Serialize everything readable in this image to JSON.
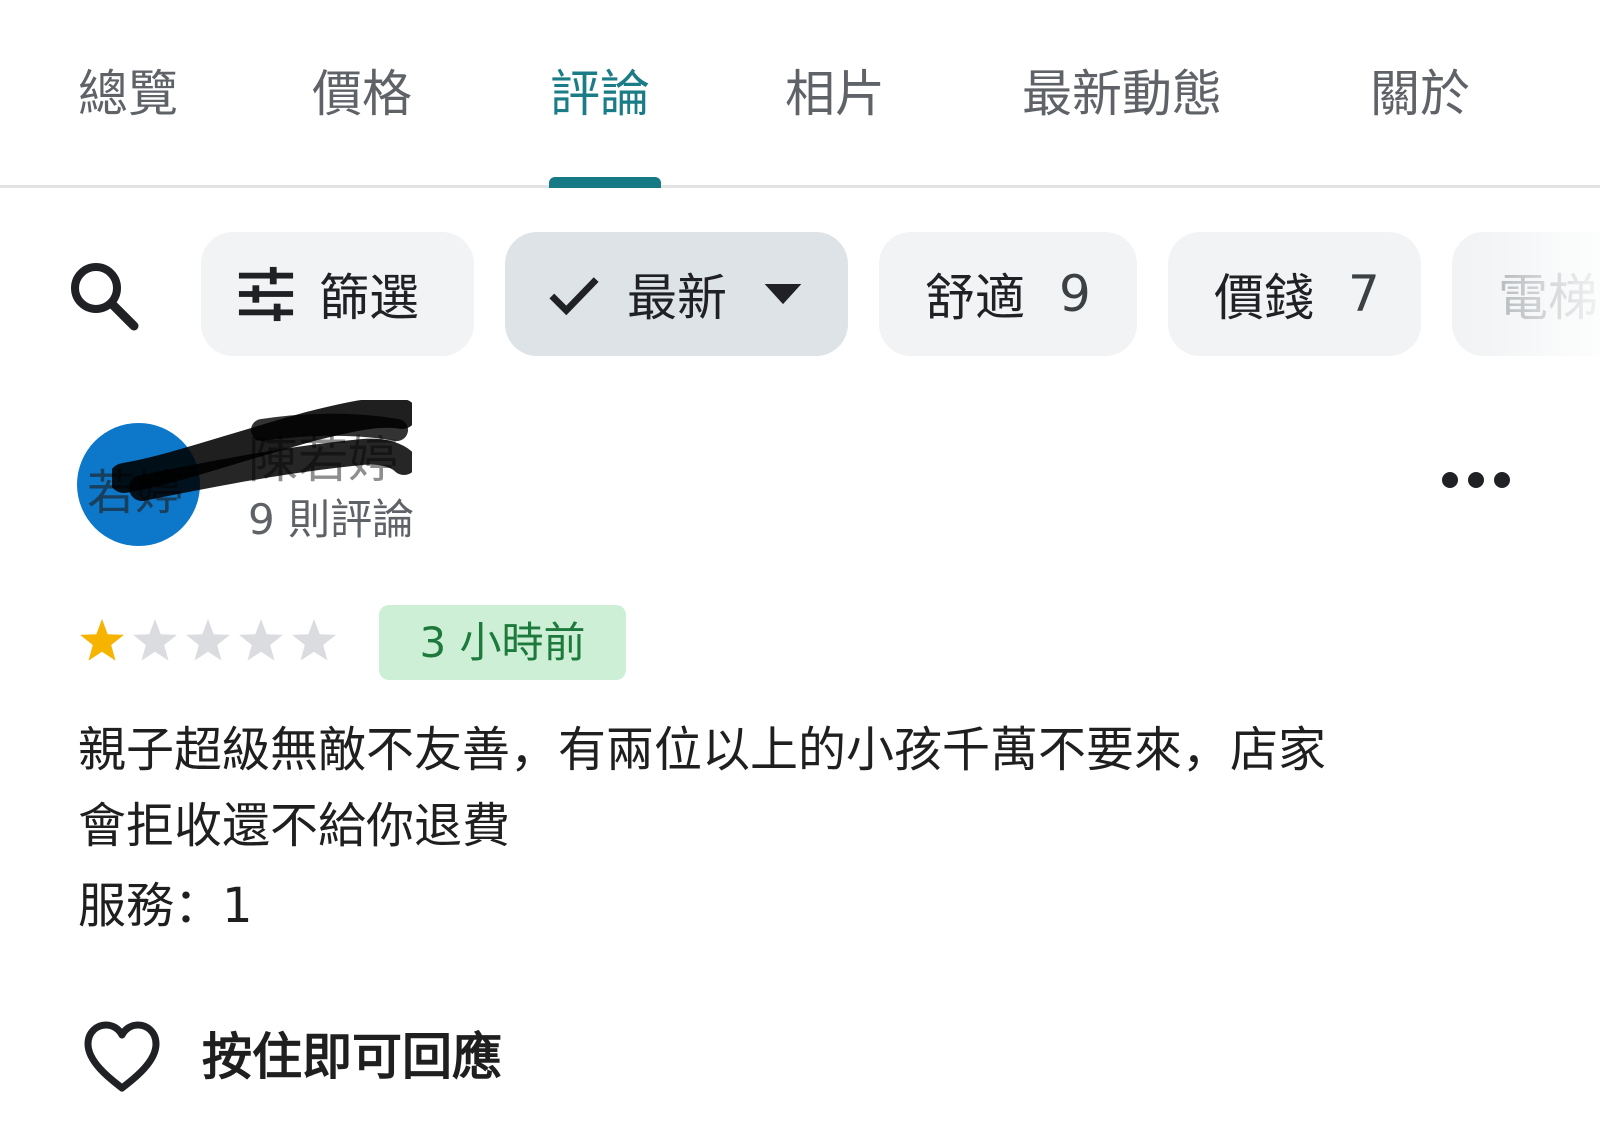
{
  "tabs": [
    {
      "label": "總覽"
    },
    {
      "label": "價格"
    },
    {
      "label": "評論"
    },
    {
      "label": "相片"
    },
    {
      "label": "最新動態"
    },
    {
      "label": "關於"
    }
  ],
  "active_tab_index": 2,
  "accent_color": "#157a84",
  "filters": {
    "search_icon": "search-icon",
    "filter_chip": {
      "icon": "tune-icon",
      "label": "篩選"
    },
    "sort_chip": {
      "check_icon": "check-icon",
      "label": "最新",
      "dropdown_icon": "arrow-drop-down-icon"
    },
    "topic_chips": [
      {
        "label": "舒適",
        "count": "9"
      },
      {
        "label": "價錢",
        "count": "7"
      },
      {
        "label": "電梯"
      }
    ]
  },
  "reviewer": {
    "avatar_initials": "若婷",
    "avatar_color": "#0d78c9",
    "name": "陳若婷",
    "review_count": "9 則評論",
    "more_icon": "more-horiz-icon"
  },
  "review": {
    "rating": 1,
    "rating_max": 5,
    "star_filled_color": "#f6b300",
    "star_empty_color": "#dadce0",
    "time_ago": "3 小時前",
    "text_lines": [
      "親子超級無敵不友善，有兩位以上的小孩千萬不要來，店家",
      "會拒收還不給你退費"
    ],
    "service_line": "服務：1"
  },
  "reaction": {
    "icon": "heart-outline-icon",
    "label": "按住即可回應"
  }
}
